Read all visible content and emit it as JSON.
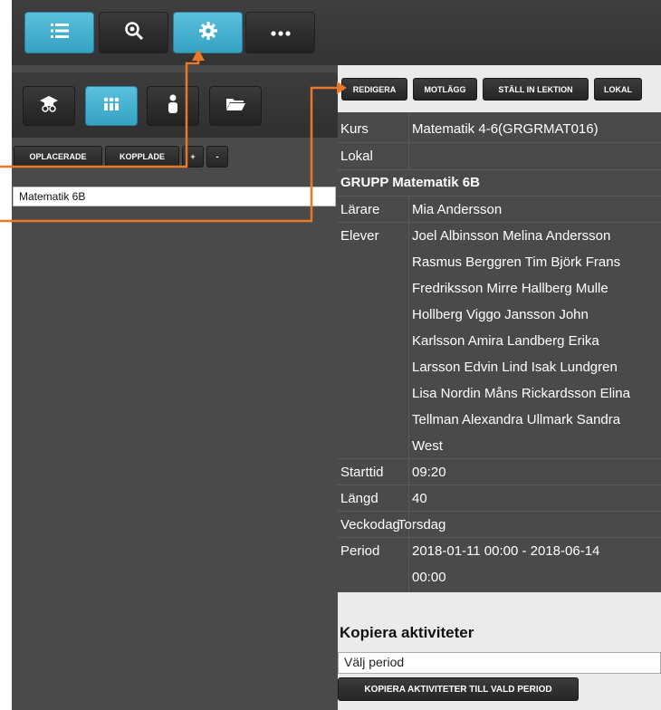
{
  "toolbar": {
    "buttons": [
      {
        "icon": "list-icon",
        "active": true
      },
      {
        "icon": "search-icon",
        "active": false
      },
      {
        "icon": "gear-icon",
        "active": true
      },
      {
        "icon": "more-icon",
        "active": false
      }
    ]
  },
  "view_buttons": [
    {
      "icon": "graduation-cap-icon",
      "active": false
    },
    {
      "icon": "group-icon",
      "active": true
    },
    {
      "icon": "person-icon",
      "active": false
    },
    {
      "icon": "folder-icon",
      "active": false
    }
  ],
  "filter": {
    "oplacerade": "OPLACERADE",
    "kopplade": "KOPPLADE",
    "plus": "+",
    "minus": "-"
  },
  "list": {
    "items": [
      "Matematik 6B"
    ]
  },
  "actions": {
    "redigera": "REDIGERA",
    "motlagg": "MOTLÄGG",
    "stall_in": "STÄLL IN LEKTION",
    "lokal": "LOKAL"
  },
  "details": {
    "kurs_label": "Kurs",
    "kurs_value": "Matematik 4-6(GRGRMAT016)",
    "lokal_label": "Lokal",
    "lokal_value": "",
    "group_heading": "GRUPP Matematik 6B",
    "larare_label": "Lärare",
    "larare_value": "Mia Andersson",
    "elever_label": "Elever",
    "elever_lines": [
      "Joel Albinsson Melina Andersson",
      "Rasmus Berggren Tim Björk Frans",
      "Fredriksson Mirre Hallberg Mulle",
      "Hollberg Viggo Jansson John",
      "Karlsson Amira Landberg Erika",
      "Larsson Edvin Lind Isak Lundgren",
      "Lisa Nordin Måns Rickardsson Elina",
      "Tellman Alexandra Ullmark Sandra",
      "West"
    ],
    "starttid_label": "Starttid",
    "starttid_value": "09:20",
    "langd_label": "Längd",
    "langd_value": "40",
    "veckodag_label": "Veckodag",
    "veckodag_value": "Torsdag",
    "period_label": "Period",
    "period_line1": "2018-01-11 00:00 - 2018-06-14",
    "period_line2": "00:00"
  },
  "kopiera": {
    "title": "Kopiera aktiviteter",
    "placeholder": "Välj period",
    "button": "KOPIERA AKTIVITETER TILL VALD PERIOD"
  },
  "colors": {
    "accent": "#45b0d0",
    "annotation": "#e8782a"
  }
}
